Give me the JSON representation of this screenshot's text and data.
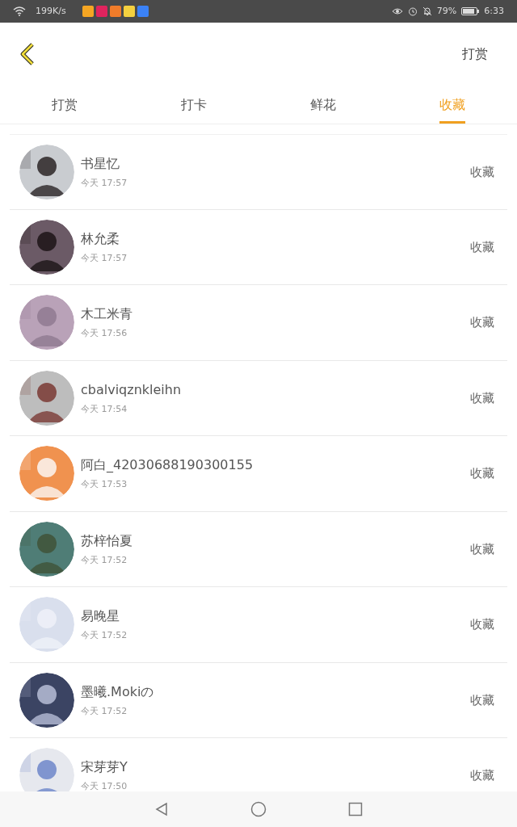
{
  "status_bar": {
    "speed": "199K/s",
    "battery": "79%",
    "time": "6:33"
  },
  "header": {
    "action": "打赏"
  },
  "tabs": [
    {
      "label": "打赏",
      "selected": false
    },
    {
      "label": "打卡",
      "selected": false
    },
    {
      "label": "鲜花",
      "selected": false
    },
    {
      "label": "收藏",
      "selected": true
    }
  ],
  "rows": [
    {
      "name": "书星忆",
      "time": "今天 17:57",
      "action": "收藏"
    },
    {
      "name": "林允柔",
      "time": "今天 17:57",
      "action": "收藏"
    },
    {
      "name": "木工米青",
      "time": "今天 17:56",
      "action": "收藏"
    },
    {
      "name": "cbalviqznkleihn",
      "time": "今天 17:54",
      "action": "收藏"
    },
    {
      "name": "阿白_42030688190300155",
      "time": "今天 17:53",
      "action": "收藏"
    },
    {
      "name": "苏梓怡夏",
      "time": "今天 17:52",
      "action": "收藏"
    },
    {
      "name": "易晚星",
      "time": "今天 17:52",
      "action": "收藏"
    },
    {
      "name": "墨曦.Mokiの",
      "time": "今天 17:52",
      "action": "收藏"
    },
    {
      "name": "宋芽芽Y",
      "time": "今天 17:50",
      "action": "收藏"
    }
  ]
}
